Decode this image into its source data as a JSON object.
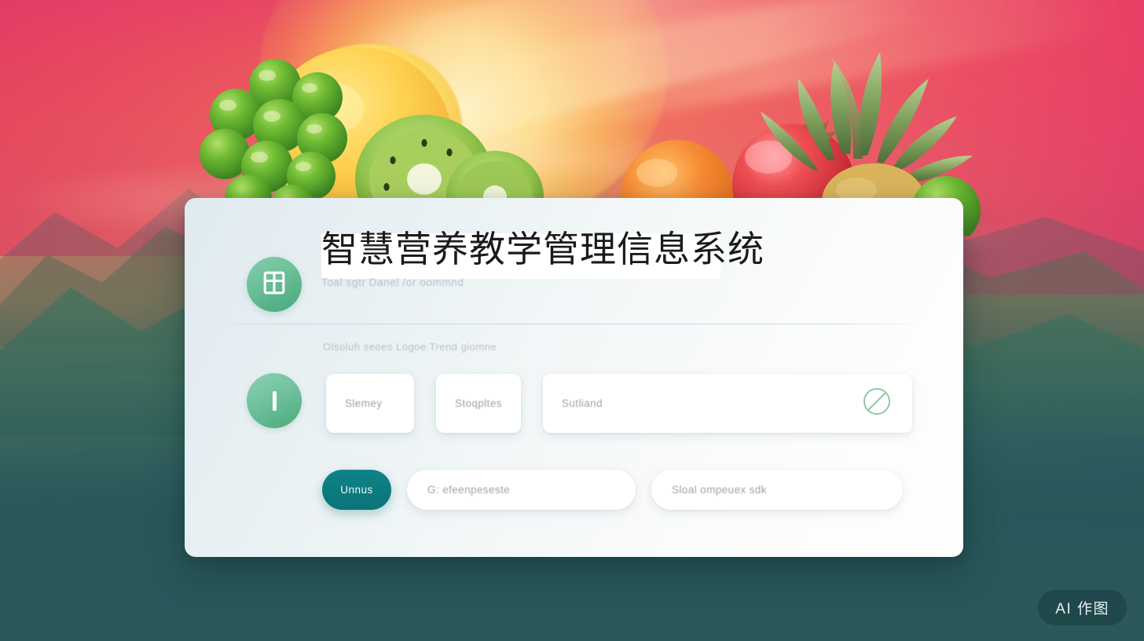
{
  "app": {
    "title": "智慧营养教学管理信息系统",
    "subtitle": "Toal sgtr  Danel /or oommnd",
    "logo_icon": "window-grid-icon",
    "accent_green": "#5cb68c",
    "accent_teal": "#0b7378",
    "card_bg": "#f3f7f8"
  },
  "section": {
    "label": "Olsoluh seoes Logoe Trend giomne"
  },
  "avatar": {
    "icon": "bar-glyph-icon"
  },
  "tiles": [
    {
      "label": "Slemey"
    },
    {
      "label": "Stoqpltes"
    },
    {
      "label": "Sutliand",
      "trailing_icon": "prohibited-circle-icon"
    }
  ],
  "actions": {
    "primary_button": "Unnus",
    "fields": [
      {
        "text": "G: efeenpeseste"
      },
      {
        "text": "Sloal ompeuex sdk"
      }
    ]
  },
  "watermark": {
    "text": "AI 作图"
  },
  "background": {
    "type": "sunset-mountains-with-fruit",
    "sky_top": "#e8466b",
    "sky_mid": "#f2705a",
    "sky_bottom": "#2a585b",
    "sun": "#ffe577",
    "items": [
      "grapes",
      "mango",
      "kiwi",
      "orange",
      "pineapple",
      "pomegranate"
    ]
  }
}
